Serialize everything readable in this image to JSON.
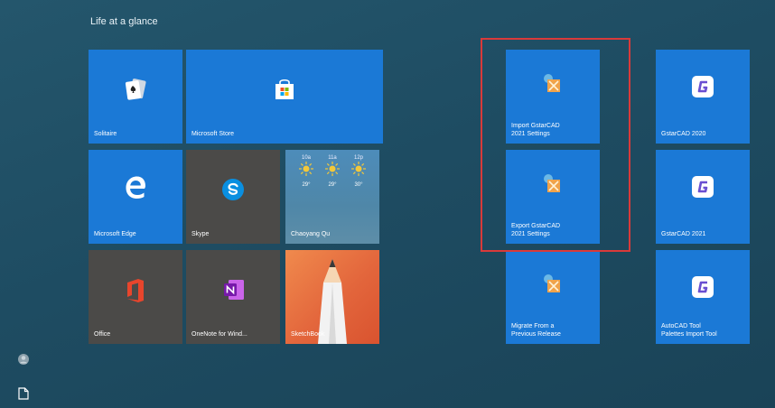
{
  "group_title": "Life at a glance",
  "tiles": {
    "solitaire": "Solitaire",
    "store": "Microsoft Store",
    "edge": "Microsoft Edge",
    "skype": "Skype",
    "weather": {
      "location": "Chaoyang Qu",
      "hours": [
        "10a",
        "11a",
        "12p"
      ],
      "temps": [
        "29°",
        "29°",
        "30°"
      ]
    },
    "office": "Office",
    "onenote": "OneNote for Wind...",
    "sketchbook": "SketchBook",
    "import_gstar": "Import GstarCAD\n2021 Settings",
    "export_gstar": "Export GstarCAD\n2021 Settings",
    "migrate": "Migrate From a\nPrevious Release",
    "gstar2020": "GstarCAD 2020",
    "gstar2021": "GstarCAD 2021",
    "autocad_palettes": "AutoCAD Tool\nPalettes Import Tool"
  },
  "icons": {
    "user": "user-icon",
    "document": "document-icon"
  },
  "colors": {
    "tile_blue": "#1b79d6",
    "tile_dark": "#4b4a48",
    "highlight_red": "#d93a3a"
  }
}
